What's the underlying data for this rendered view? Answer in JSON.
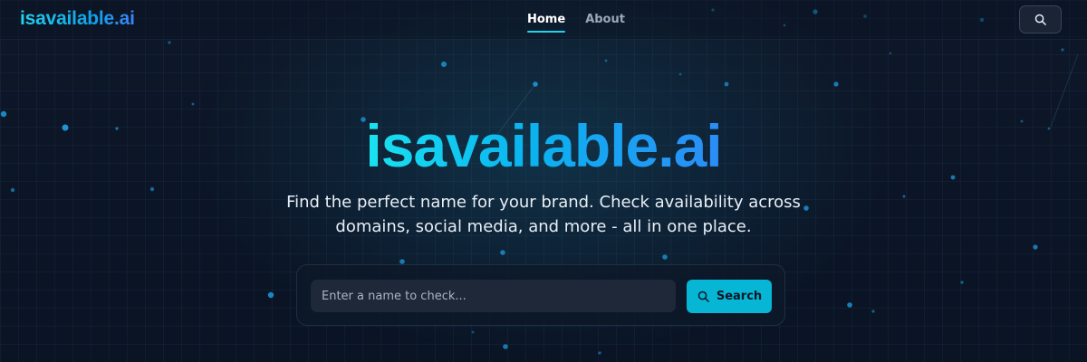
{
  "header": {
    "logo": "isavailable.ai",
    "nav": [
      {
        "label": "Home",
        "active": true
      },
      {
        "label": "About",
        "active": false
      }
    ],
    "search_icon": "search-icon"
  },
  "hero": {
    "title": "isavailable.ai",
    "subtitle_line1": "Find the perfect name for your brand. Check availability across",
    "subtitle_line2": "domains, social media, and more - all in one place."
  },
  "search": {
    "placeholder": "Enter a name to check...",
    "value": "",
    "button_label": "Search",
    "button_icon": "search-icon"
  },
  "colors": {
    "accent": "#06b6d4",
    "background": "#0b1424",
    "gradient_start": "#19e3f0",
    "gradient_end": "#2b8df7"
  }
}
